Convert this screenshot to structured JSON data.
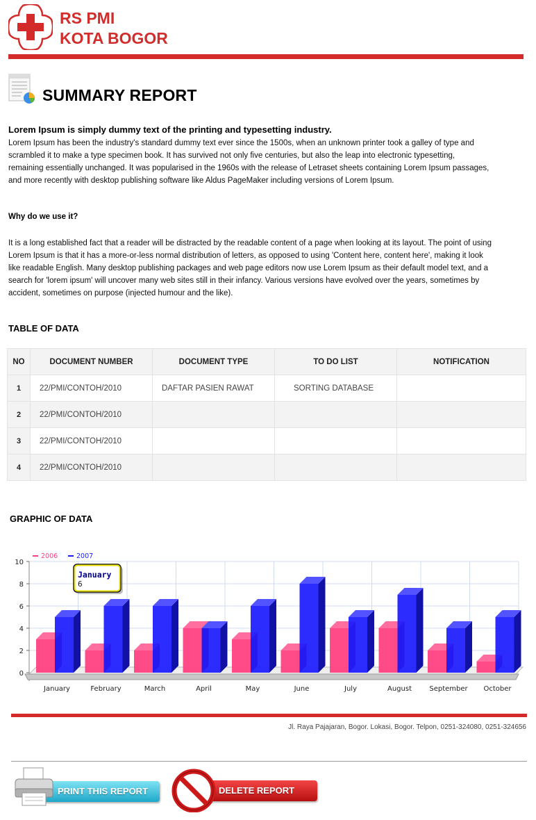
{
  "header": {
    "brand_line1": "RS PMI",
    "brand_line2": "KOTA BOGOR",
    "brand_color": "#d22d2d"
  },
  "report": {
    "title": "SUMMARY REPORT",
    "icon": "report-document-icon"
  },
  "intro": {
    "heading": "Lorem Ipsum is simply dummy text of the printing and typesetting industry.",
    "paragraph": "Lorem Ipsum has been the industry's standard dummy text ever since the 1500s, when an unknown printer took a galley of type and scrambled it to make a type specimen book. It has survived not only five centuries, but also the leap into electronic typesetting, remaining essentially unchanged. It was popularised in the 1960s with the release of Letraset sheets containing Lorem Ipsum passages, and more recently with desktop publishing software like Aldus PageMaker including versions of Lorem Ipsum."
  },
  "why": {
    "heading": "Why do we use it?",
    "paragraph": "It is a long established fact that a reader will be distracted by the readable content of a page when looking at its layout. The point of using Lorem Ipsum is that it has a more-or-less normal distribution of letters, as opposed to using 'Content here, content here', making it look like readable English. Many desktop publishing packages and web page editors now use Lorem Ipsum as their default model text, and a search for 'lorem ipsum' will uncover many web sites still in their infancy. Various versions have evolved over the years, sometimes by accident, sometimes on purpose (injected humour and the like)."
  },
  "table": {
    "heading": "TABLE OF DATA",
    "columns": [
      "NO",
      "DOCUMENT NUMBER",
      "DOCUMENT TYPE",
      "TO DO LIST",
      "NOTIFICATION"
    ],
    "rows": [
      [
        "1",
        "22/PMI/CONTOH/2010",
        "DAFTAR PASIEN RAWAT",
        "SORTING  DATABASE",
        ""
      ],
      [
        "2",
        "22/PMI/CONTOH/2010",
        "",
        "",
        ""
      ],
      [
        "3",
        "22/PMI/CONTOH/2010",
        "",
        "",
        ""
      ],
      [
        "4",
        "22/PMI/CONTOH/2010",
        "",
        "",
        ""
      ]
    ]
  },
  "graphic": {
    "heading": "GRAPHIC OF DATA",
    "tooltip": {
      "title": "January",
      "value": "6"
    }
  },
  "chart_data": {
    "type": "bar",
    "categories": [
      "January",
      "February",
      "March",
      "April",
      "May",
      "June",
      "July",
      "August",
      "September",
      "October"
    ],
    "series": [
      {
        "name": "2006",
        "color": "#ff3d7f",
        "values": [
          3,
          2,
          2,
          4,
          3,
          2,
          4,
          4,
          2,
          1
        ]
      },
      {
        "name": "2007",
        "color": "#1a1aff",
        "values": [
          5,
          6,
          6,
          4,
          6,
          8,
          5,
          7,
          4,
          5
        ]
      }
    ],
    "yticks": [
      0,
      2,
      4,
      6,
      8,
      10
    ],
    "ylim": [
      0,
      10
    ],
    "grid": true,
    "legend": "top-left",
    "style": "3d-columns"
  },
  "footer": {
    "address": "Jl. Raya Pajajaran, Bogor. Lokasi, Bogor. Telpon, 0251-324080, 0251-324656"
  },
  "actions": {
    "print_label": "PRINT THIS REPORT",
    "print_icon": "printer-icon",
    "delete_label": "DELETE REPORT",
    "delete_icon": "no-entry-icon",
    "print_color": "#1da7c9",
    "delete_color": "#b60f10"
  }
}
